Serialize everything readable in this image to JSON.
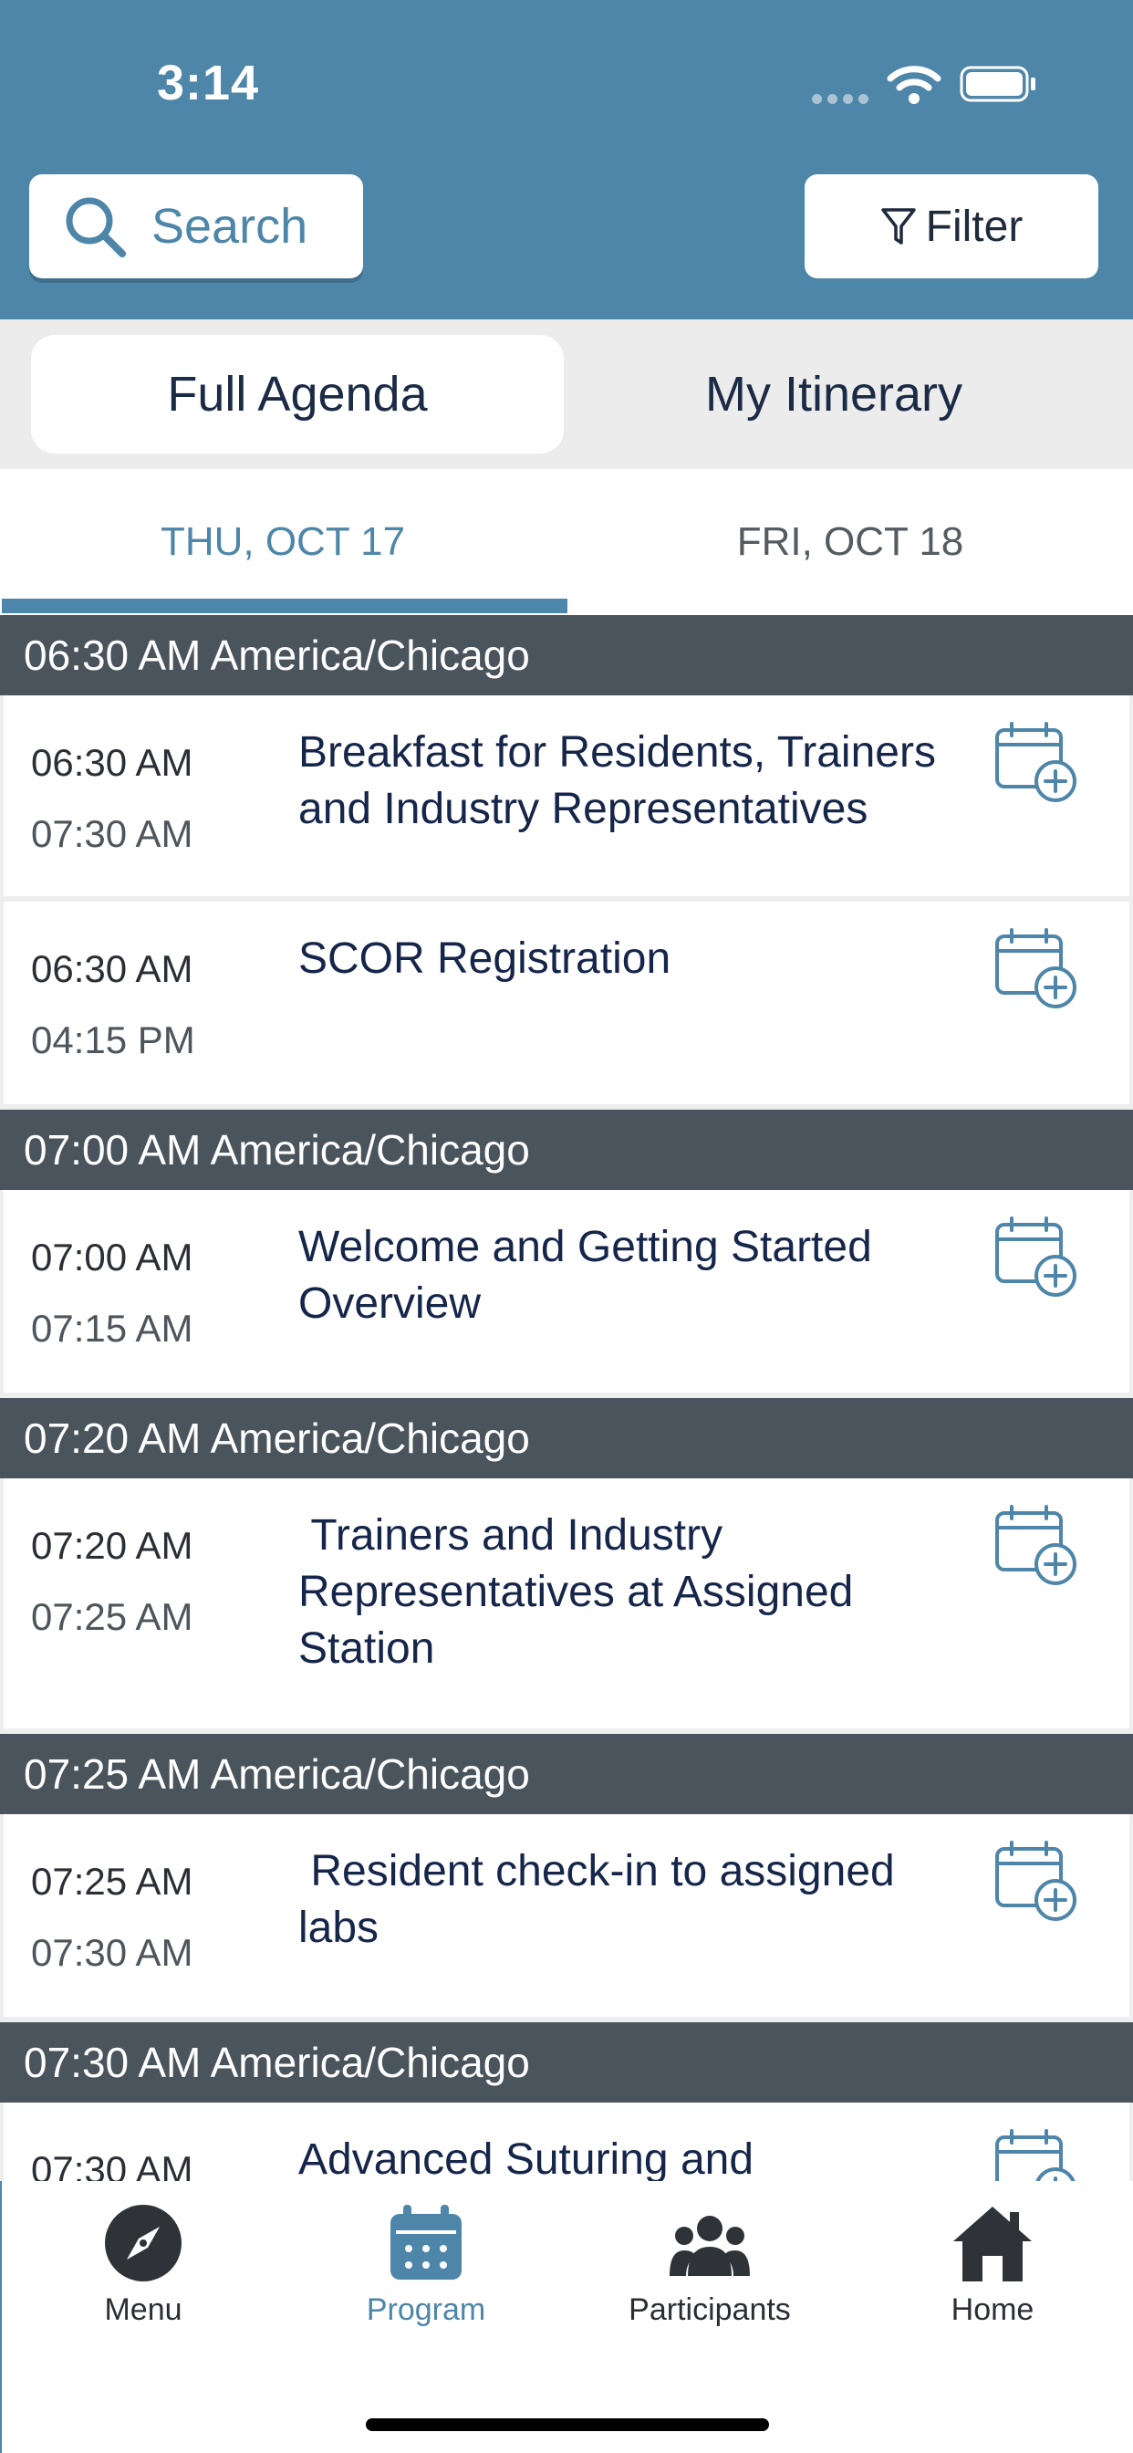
{
  "status_bar": {
    "time": "3:14"
  },
  "header": {
    "search_label": "Search",
    "filter_label": "Filter"
  },
  "segments": {
    "full_agenda": "Full Agenda",
    "my_itinerary": "My Itinerary"
  },
  "day_tabs": {
    "first": "THU, OCT 17",
    "second": "FRI, OCT 18",
    "selected": "THU, OCT 17"
  },
  "groups": [
    {
      "header": "06:30 AM America/Chicago",
      "items": [
        {
          "start": "06:30 AM",
          "end": "07:30 AM",
          "title": "Breakfast for Residents, Trainers and Industry Representatives"
        },
        {
          "start": "06:30 AM",
          "end": "04:15 PM",
          "title": "SCOR Registration"
        }
      ]
    },
    {
      "header": "07:00 AM America/Chicago",
      "items": [
        {
          "start": "07:00 AM",
          "end": "07:15 AM",
          "title": "Welcome and Getting Started Overview"
        }
      ]
    },
    {
      "header": "07:20 AM America/Chicago",
      "items": [
        {
          "start": "07:20 AM",
          "end": "07:25 AM",
          "title": " Trainers and Industry Representatives at Assigned Station"
        }
      ]
    },
    {
      "header": "07:25 AM America/Chicago",
      "items": [
        {
          "start": "07:25 AM",
          "end": "07:30 AM",
          "title": " Resident check-in to assigned labs"
        }
      ]
    },
    {
      "header": "07:30 AM America/Chicago",
      "items": [
        {
          "start": "07:30 AM",
          "end": "",
          "title": "Advanced Suturing and"
        }
      ]
    }
  ],
  "bottom_nav": {
    "menu": "Menu",
    "program": "Program",
    "participants": "Participants",
    "home": "Home",
    "active": "Program"
  },
  "colors": {
    "brand": "#4e86a9",
    "group_header": "#4a545c",
    "title_text": "#16264a",
    "segment_bg": "#ececed"
  },
  "icons": {
    "search": "search-icon",
    "filter": "filter-icon",
    "add_to_calendar": "calendar-add-icon",
    "menu": "compass-icon",
    "program": "calendar-icon",
    "participants": "people-icon",
    "home": "home-icon"
  }
}
